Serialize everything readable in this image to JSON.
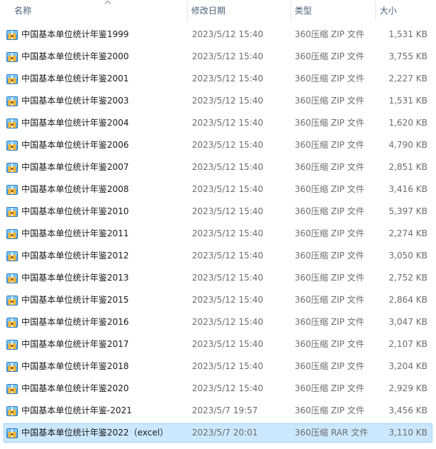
{
  "columns": {
    "name": "名称",
    "date": "修改日期",
    "type": "类型",
    "size": "大小"
  },
  "icons": {
    "sort": "sort-ascending-icon",
    "file": "zip-archive-icon"
  },
  "colors": {
    "selection_bg": "#cce8ff",
    "selection_border": "#99d1ff",
    "header_text": "#4c607a"
  },
  "files": [
    {
      "name": "中国基本单位统计年鉴1999",
      "date": "2023/5/12 15:40",
      "type": "360压缩 ZIP 文件",
      "size": "1,531 KB"
    },
    {
      "name": "中国基本单位统计年鉴2000",
      "date": "2023/5/12 15:40",
      "type": "360压缩 ZIP 文件",
      "size": "3,755 KB"
    },
    {
      "name": "中国基本单位统计年鉴2001",
      "date": "2023/5/12 15:40",
      "type": "360压缩 ZIP 文件",
      "size": "2,227 KB"
    },
    {
      "name": "中国基本单位统计年鉴2003",
      "date": "2023/5/12 15:40",
      "type": "360压缩 ZIP 文件",
      "size": "1,531 KB"
    },
    {
      "name": "中国基本单位统计年鉴2004",
      "date": "2023/5/12 15:40",
      "type": "360压缩 ZIP 文件",
      "size": "1,620 KB"
    },
    {
      "name": "中国基本单位统计年鉴2006",
      "date": "2023/5/12 15:40",
      "type": "360压缩 ZIP 文件",
      "size": "4,790 KB"
    },
    {
      "name": "中国基本单位统计年鉴2007",
      "date": "2023/5/12 15:40",
      "type": "360压缩 ZIP 文件",
      "size": "2,851 KB"
    },
    {
      "name": "中国基本单位统计年鉴2008",
      "date": "2023/5/12 15:40",
      "type": "360压缩 ZIP 文件",
      "size": "3,416 KB"
    },
    {
      "name": "中国基本单位统计年鉴2010",
      "date": "2023/5/12 15:40",
      "type": "360压缩 ZIP 文件",
      "size": "5,397 KB"
    },
    {
      "name": "中国基本单位统计年鉴2011",
      "date": "2023/5/12 15:40",
      "type": "360压缩 ZIP 文件",
      "size": "2,274 KB"
    },
    {
      "name": "中国基本单位统计年鉴2012",
      "date": "2023/5/12 15:40",
      "type": "360压缩 ZIP 文件",
      "size": "3,050 KB"
    },
    {
      "name": "中国基本单位统计年鉴2013",
      "date": "2023/5/12 15:40",
      "type": "360压缩 ZIP 文件",
      "size": "2,752 KB"
    },
    {
      "name": "中国基本单位统计年鉴2015",
      "date": "2023/5/12 15:40",
      "type": "360压缩 ZIP 文件",
      "size": "2,864 KB"
    },
    {
      "name": "中国基本单位统计年鉴2016",
      "date": "2023/5/12 15:40",
      "type": "360压缩 ZIP 文件",
      "size": "3,047 KB"
    },
    {
      "name": "中国基本单位统计年鉴2017",
      "date": "2023/5/12 15:40",
      "type": "360压缩 ZIP 文件",
      "size": "2,107 KB"
    },
    {
      "name": "中国基本单位统计年鉴2018",
      "date": "2023/5/12 15:40",
      "type": "360压缩 ZIP 文件",
      "size": "3,204 KB"
    },
    {
      "name": "中国基本单位统计年鉴2020",
      "date": "2023/5/12 15:40",
      "type": "360压缩 ZIP 文件",
      "size": "2,929 KB"
    },
    {
      "name": "中国基本单位统计年鉴-2021",
      "date": "2023/5/7 19:57",
      "type": "360压缩 ZIP 文件",
      "size": "3,456 KB"
    },
    {
      "name": "中国基本单位统计年鉴2022（excel）",
      "date": "2023/5/7 20:01",
      "type": "360压缩 RAR 文件",
      "size": "3,110 KB",
      "selected": true
    }
  ]
}
